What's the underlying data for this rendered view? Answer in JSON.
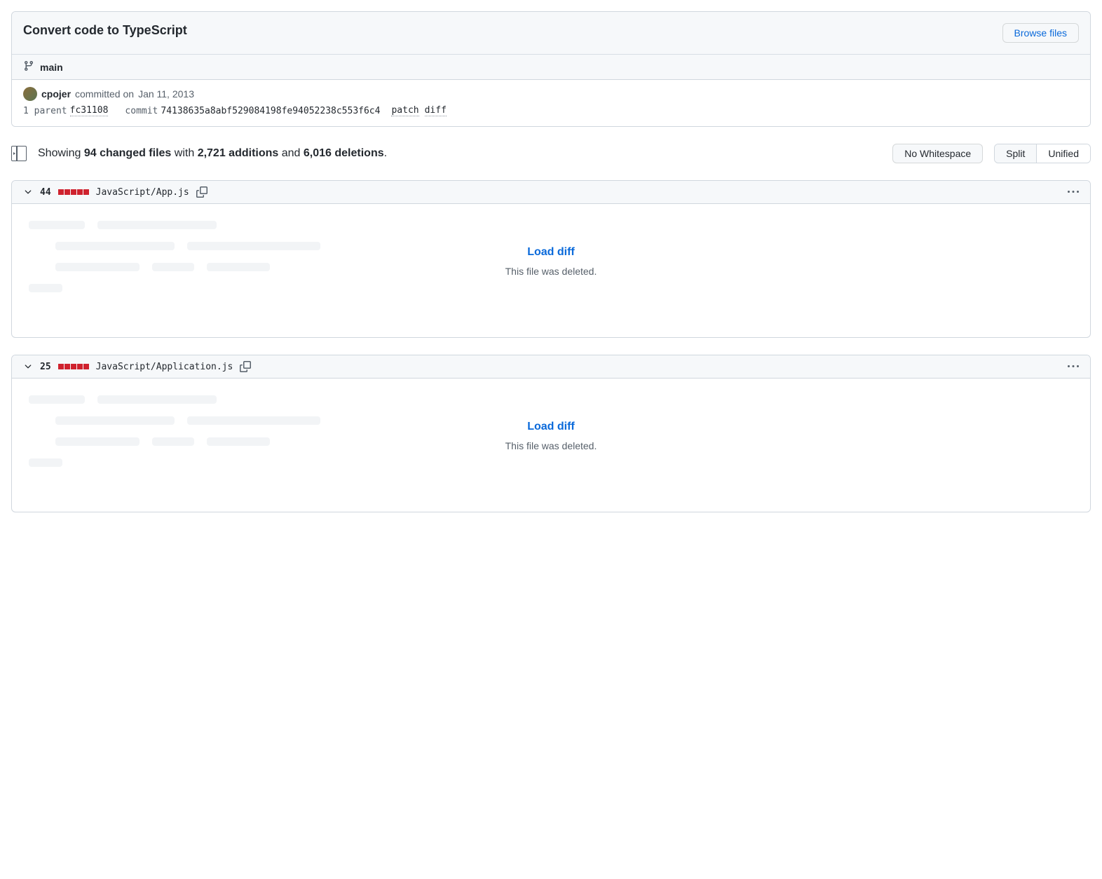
{
  "commit": {
    "title": "Convert code to TypeScript",
    "browse_files": "Browse files",
    "branch": "main",
    "author": "cpojer",
    "committed_text": "committed on",
    "date": "Jan 11, 2013",
    "parent_label": "1 parent",
    "parent_sha": "fc31108",
    "commit_label": "commit",
    "full_sha": "74138635a8abf529084198fe94052238c553f6c4",
    "patch_label": "patch",
    "diff_label": "diff"
  },
  "summary": {
    "showing": "Showing",
    "files_count": "94 changed files",
    "with": "with",
    "additions": "2,721 additions",
    "and": "and",
    "deletions": "6,016 deletions",
    "dot": "."
  },
  "toolbar": {
    "no_whitespace": "No Whitespace",
    "split": "Split",
    "unified": "Unified"
  },
  "files": [
    {
      "changes": "44",
      "path": "JavaScript/App.js",
      "load_diff": "Load diff",
      "deleted": "This file was deleted."
    },
    {
      "changes": "25",
      "path": "JavaScript/Application.js",
      "load_diff": "Load diff",
      "deleted": "This file was deleted."
    }
  ]
}
